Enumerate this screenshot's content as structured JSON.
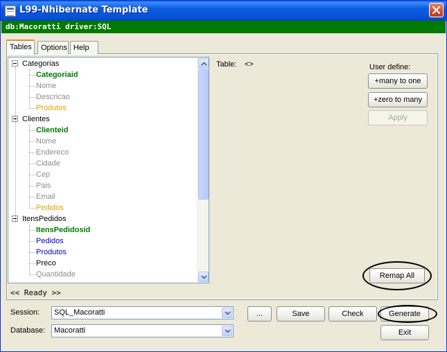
{
  "window": {
    "title": "L99-Nhibernate Template"
  },
  "db_bar": "db:Macoratti driver:SQL",
  "tabs": [
    {
      "label": "Tables",
      "active": true
    },
    {
      "label": "Options",
      "active": false
    },
    {
      "label": "Help",
      "active": false
    }
  ],
  "tree": {
    "nodes": [
      {
        "label": "Categorias",
        "kind": "table"
      },
      {
        "label": "Categoriaid",
        "kind": "key"
      },
      {
        "label": "Nome",
        "kind": "column"
      },
      {
        "label": "Descricao",
        "kind": "column"
      },
      {
        "label": "Produtos",
        "kind": "relation"
      },
      {
        "label": "Clientes",
        "kind": "table"
      },
      {
        "label": "Clienteid",
        "kind": "key"
      },
      {
        "label": "Nome",
        "kind": "column"
      },
      {
        "label": "Endereco",
        "kind": "column"
      },
      {
        "label": "Cidade",
        "kind": "column"
      },
      {
        "label": "Cep",
        "kind": "column"
      },
      {
        "label": "Pais",
        "kind": "column"
      },
      {
        "label": "Email",
        "kind": "column"
      },
      {
        "label": "Pedidos",
        "kind": "relation"
      },
      {
        "label": "ItensPedidos",
        "kind": "table"
      },
      {
        "label": "ItensPedidosid",
        "kind": "key"
      },
      {
        "label": "Pedidos",
        "kind": "foreign"
      },
      {
        "label": "Produtos",
        "kind": "foreign"
      },
      {
        "label": "Preco",
        "kind": "plain"
      },
      {
        "label": "Quantidade",
        "kind": "column"
      }
    ]
  },
  "status": "<< Ready >>",
  "table_info": {
    "label": "Table:",
    "value": "<>"
  },
  "user_define": {
    "label": "User define:",
    "buttons": {
      "many_to_one": "+many to one",
      "zero_to_many": "+zero to many",
      "apply": "Apply"
    }
  },
  "remap_all": "Remap All",
  "session": {
    "label": "Session:",
    "value": "SQL_Macoratti"
  },
  "database": {
    "label": "Database:",
    "value": "Macoratti"
  },
  "actions": {
    "browse": "...",
    "save": "Save",
    "check": "Check",
    "generate": "Generate",
    "exit": "Exit"
  },
  "colors": {
    "titlebar": "#0551d6",
    "db_bar": "#007a00",
    "key": "#007a00",
    "relation": "#e0a000",
    "foreign": "#0000c0",
    "column": "#8c8c8c"
  }
}
